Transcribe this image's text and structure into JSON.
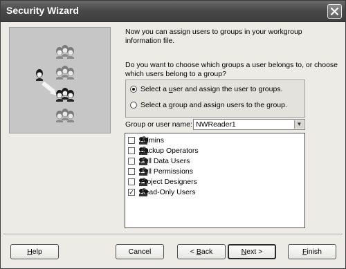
{
  "window": {
    "title": "Security Wizard"
  },
  "intro_text": [
    "Now you can assign users to groups in your workgroup",
    "information file."
  ],
  "question_text": [
    "Do you want to choose which groups a user belongs to, or choose",
    "which users belong to a group?"
  ],
  "options": [
    {
      "label_pre": "Select a ",
      "label_accel": "u",
      "label_post": "ser and assign the user to groups.",
      "selected": true
    },
    {
      "label_pre": "Select a ",
      "label_accel": "g",
      "label_post": "roup and assign users to the group.",
      "selected": false
    }
  ],
  "group_user_label": "Group or user name:",
  "group_user_value": "NWReader1",
  "groups": [
    {
      "label": "Admins",
      "checked": false
    },
    {
      "label": "Backup Operators",
      "checked": false
    },
    {
      "label": "Full Data Users",
      "checked": false
    },
    {
      "label": "Full Permissions",
      "checked": false
    },
    {
      "label": "Project Designers",
      "checked": false
    },
    {
      "label": "Read-Only Users",
      "checked": true
    }
  ],
  "buttons": {
    "help": {
      "accel": "H",
      "rest": "elp"
    },
    "cancel": "Cancel",
    "back": {
      "pre": "< ",
      "accel": "B",
      "rest": "ack"
    },
    "next": {
      "accel": "N",
      "rest": "ext >"
    },
    "finish": {
      "accel": "F",
      "rest": "inish"
    }
  },
  "icons": {
    "close": "close-icon",
    "art": "users-groups-illustration",
    "group": "group-icon",
    "dropdown": "chevron-down-icon"
  }
}
